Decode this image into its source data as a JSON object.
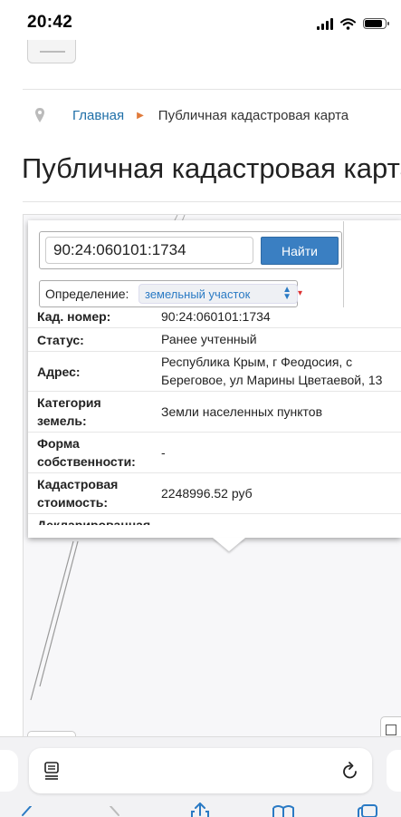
{
  "status_bar": {
    "time": "20:42"
  },
  "breadcrumb": {
    "home": "Главная",
    "current": "Публичная кадастровая карта"
  },
  "page": {
    "title": "Публичная кадастровая карта"
  },
  "search": {
    "value": "90:24:060101:1734",
    "button": "Найти"
  },
  "definition": {
    "label": "Определение:",
    "selected": "земельный участок"
  },
  "info_rows": [
    {
      "key": "Кад. номер:",
      "value": "90:24:060101:1734"
    },
    {
      "key": "Статус:",
      "value": "Ранее учтенный"
    },
    {
      "key": "Адрес:",
      "value_line1": "Республика Крым, г Феодосия, с",
      "value_line2": "Береговое, ул Марины Цветаевой, 13"
    },
    {
      "key_line1": "Категория",
      "key_line2": "земель:",
      "value": "Земли населенных пунктов"
    },
    {
      "key_line1": "Форма",
      "key_line2": "собственности:",
      "value": "-"
    },
    {
      "key_line1": "Кадастровая",
      "key_line2": "стоимость:",
      "value": "2248996.52 руб"
    },
    {
      "key": "Декларированная"
    }
  ],
  "icons": {
    "menu": "hamburger-icon",
    "location": "pin-icon",
    "breadcrumb_separator": "triangle-right-icon",
    "select": "chevron-updown-icon",
    "fullscreen": "fullscreen-icon",
    "reader": "reader-icon",
    "reload": "reload-icon",
    "back": "back-icon",
    "forward": "forward-icon",
    "share": "share-icon",
    "bookmarks": "bookmarks-icon",
    "tabs": "tabs-icon"
  },
  "colors": {
    "link": "#1f6fa8",
    "breadcrumb_separator": "#e07a3a",
    "button": "#3a7fc2",
    "select_text": "#2a7ac4"
  }
}
